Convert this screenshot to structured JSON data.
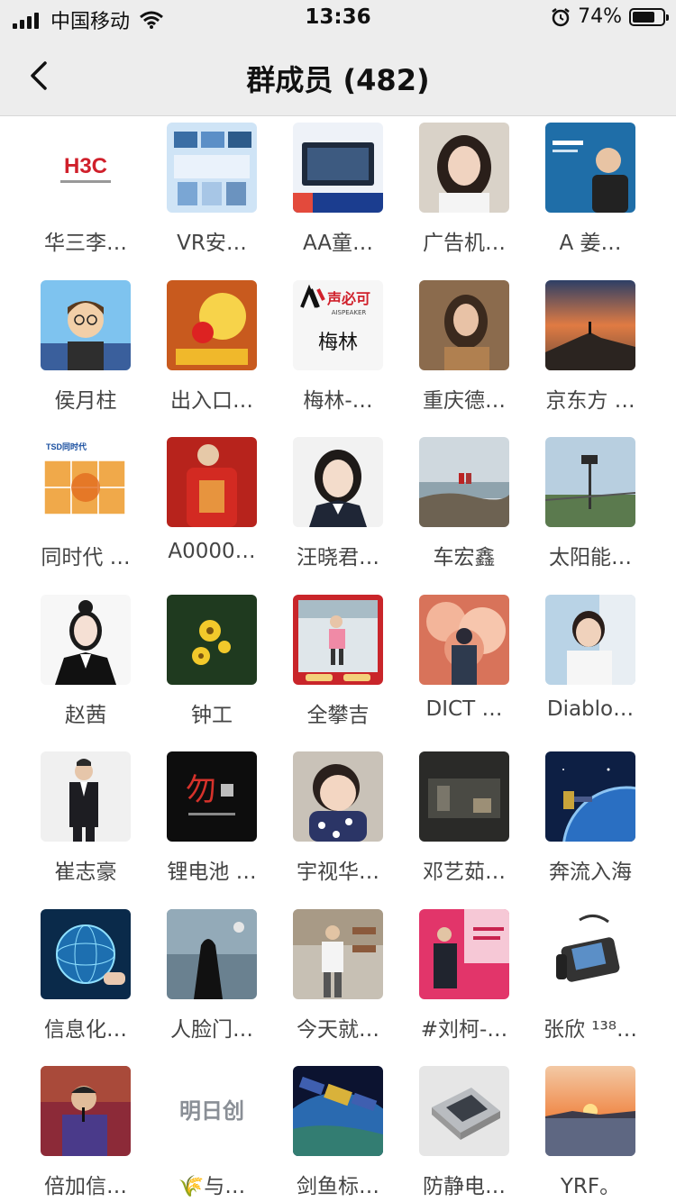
{
  "status_bar": {
    "carrier": "中国移动",
    "time": "13:36",
    "battery_percent": "74%",
    "battery_level": 0.74
  },
  "nav": {
    "title": "群成员 (482)",
    "back_icon": "chevron-left-icon"
  },
  "members": [
    {
      "name": "华三李…",
      "avatar": "h3c-logo"
    },
    {
      "name": "VR安…",
      "avatar": "vr-poster"
    },
    {
      "name": "AA童…",
      "avatar": "device-screen"
    },
    {
      "name": "广告机…",
      "avatar": "woman-portrait"
    },
    {
      "name": "A  姜…",
      "avatar": "man-blue-poster"
    },
    {
      "name": "侯月柱",
      "avatar": "cartoon-man"
    },
    {
      "name": "出入口…",
      "avatar": "rooster-gold"
    },
    {
      "name": "梅林-…",
      "avatar": "aispeaker-logo"
    },
    {
      "name": "重庆德…",
      "avatar": "woman-warm"
    },
    {
      "name": "京东方 …",
      "avatar": "sunset-peak"
    },
    {
      "name": "同时代 …",
      "avatar": "video-wall"
    },
    {
      "name": "A0000…",
      "avatar": "red-shirt"
    },
    {
      "name": "汪晓君…",
      "avatar": "woman-id-photo"
    },
    {
      "name": "车宏鑫",
      "avatar": "seaside-rocks"
    },
    {
      "name": "太阳能…",
      "avatar": "solar-light"
    },
    {
      "name": "赵茜",
      "avatar": "illustrated-woman"
    },
    {
      "name": "钟工",
      "avatar": "yellow-flowers"
    },
    {
      "name": "全攀吉",
      "avatar": "child-red-frame"
    },
    {
      "name": "DICT …",
      "avatar": "clouds-figure"
    },
    {
      "name": "Diablo…",
      "avatar": "young-man"
    },
    {
      "name": "崔志豪",
      "avatar": "man-suit"
    },
    {
      "name": "锂电池 …",
      "avatar": "calligraphy-black"
    },
    {
      "name": "宇视华…",
      "avatar": "baby"
    },
    {
      "name": "邓艺茹…",
      "avatar": "dark-room"
    },
    {
      "name": "奔流入海",
      "avatar": "space-satellite"
    },
    {
      "name": "信息化…",
      "avatar": "tech-globe"
    },
    {
      "name": "人脸门…",
      "avatar": "dark-figure"
    },
    {
      "name": "今天就…",
      "avatar": "shop-man"
    },
    {
      "name": "#刘柯-…",
      "avatar": "presenter-pink"
    },
    {
      "name": "张欣 ¹³⁸…",
      "avatar": "desk-phone"
    },
    {
      "name": "倍加信…",
      "avatar": "speaker-man"
    },
    {
      "name": "🌾与…",
      "avatar": "mingrichuang-logo"
    },
    {
      "name": "剑鱼标…",
      "avatar": "satellite-earth"
    },
    {
      "name": "防静电…",
      "avatar": "floor-tile"
    },
    {
      "name": "YRF。",
      "avatar": "sea-sunset"
    }
  ],
  "logo_texts": {
    "h3c": "H3C",
    "aispeaker": "声必可",
    "aispeaker_sub": "AISPEAKER",
    "meilin": "梅林",
    "tsd": "TSD同时代",
    "mrc": "明日创",
    "calligraphy": "勿"
  }
}
